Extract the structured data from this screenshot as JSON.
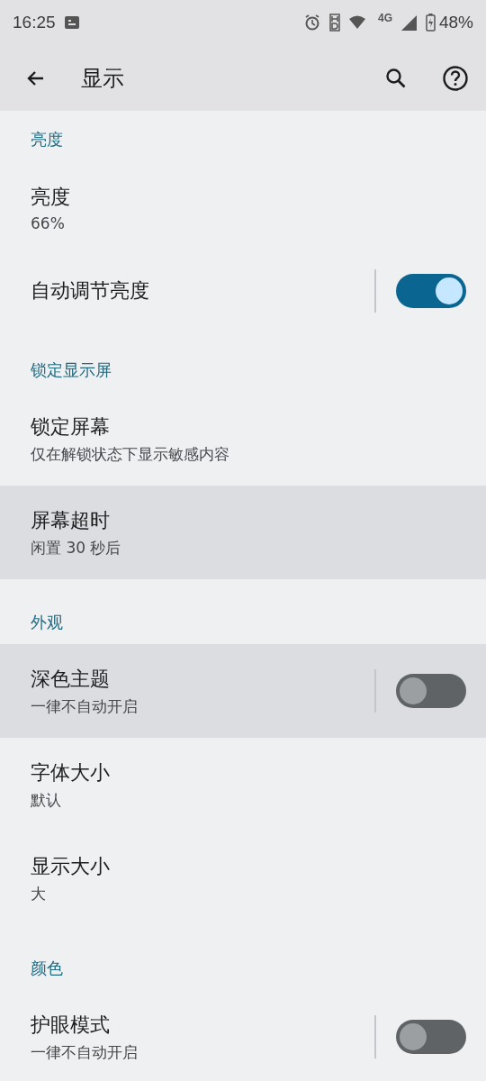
{
  "status_bar": {
    "time": "16:25",
    "network": "4G",
    "battery": "48%"
  },
  "toolbar": {
    "title": "显示"
  },
  "sections": [
    {
      "header": "亮度",
      "items": [
        {
          "kind": "text",
          "title": "亮度",
          "subtitle": "66%",
          "highlighted": false
        },
        {
          "kind": "switch",
          "title": "自动调节亮度",
          "on": true,
          "highlighted": false
        }
      ]
    },
    {
      "header": "锁定显示屏",
      "items": [
        {
          "kind": "text",
          "title": "锁定屏幕",
          "subtitle": "仅在解锁状态下显示敏感内容",
          "highlighted": false
        },
        {
          "kind": "text",
          "title": "屏幕超时",
          "subtitle": "闲置 30 秒后",
          "highlighted": true
        }
      ]
    },
    {
      "header": "外观",
      "items": [
        {
          "kind": "switch",
          "title": "深色主题",
          "subtitle": "一律不自动开启",
          "on": false,
          "highlighted": true
        },
        {
          "kind": "text",
          "title": "字体大小",
          "subtitle": "默认",
          "highlighted": false
        },
        {
          "kind": "text",
          "title": "显示大小",
          "subtitle": "大",
          "highlighted": false
        }
      ]
    },
    {
      "header": "颜色",
      "items": [
        {
          "kind": "switch",
          "title": "护眼模式",
          "subtitle": "一律不自动开启",
          "on": false,
          "highlighted": false
        }
      ]
    }
  ]
}
